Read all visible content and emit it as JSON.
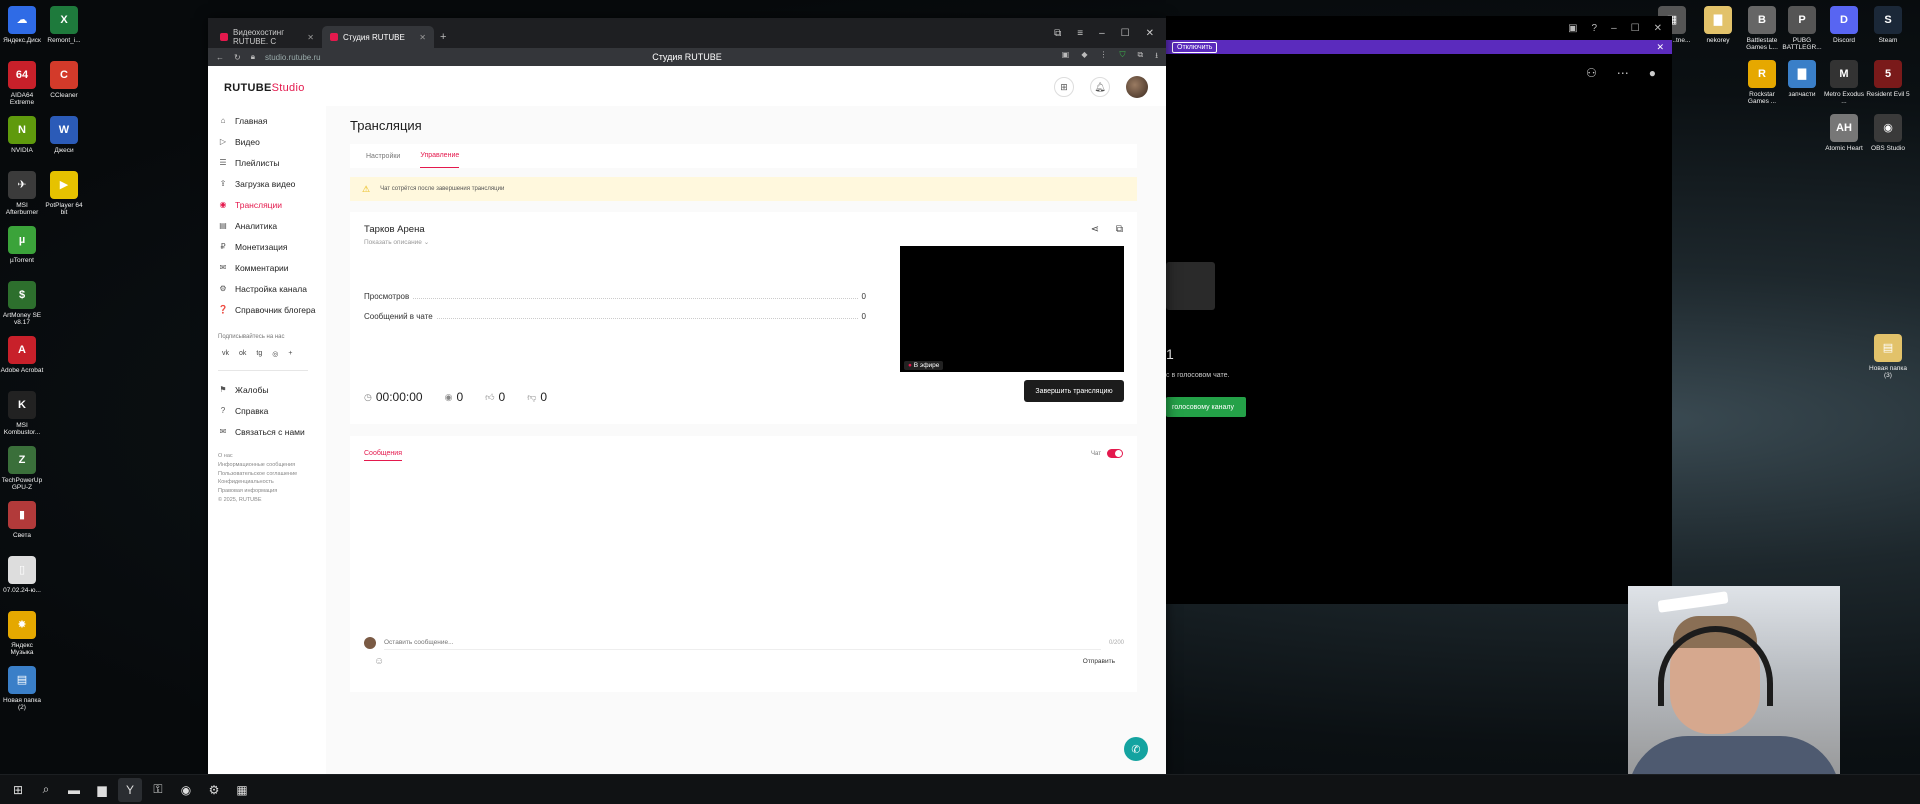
{
  "desktop": {
    "icons_left": [
      {
        "label": "Яндекс.Диск",
        "glyph": "☁",
        "color": "#2f6be6"
      },
      {
        "label": "AIDA64 Extreme",
        "glyph": "64",
        "color": "#c8202a"
      },
      {
        "label": "NVIDIA",
        "glyph": "N",
        "color": "#5f9a0d"
      },
      {
        "label": "MSI Afterburner",
        "glyph": "✈",
        "color": "#3b3b3b"
      },
      {
        "label": "µTorrent",
        "glyph": "µ",
        "color": "#3ba33a"
      },
      {
        "label": "ArtMoney SE v8.17",
        "glyph": "$",
        "color": "#2d6f2d"
      },
      {
        "label": "Adobe Acrobat",
        "glyph": "A",
        "color": "#c8202a"
      },
      {
        "label": "MSI Kombustor...",
        "glyph": "K",
        "color": "#222222"
      },
      {
        "label": "TechPowerUp GPU-Z",
        "glyph": "Z",
        "color": "#3a6f3a"
      },
      {
        "label": "Света",
        "glyph": "▮",
        "color": "#b23a3a"
      },
      {
        "label": "07.02.24-ю...",
        "glyph": "▯",
        "color": "#dddddd"
      },
      {
        "label": "Яндекс Музыка",
        "glyph": "✸",
        "color": "#e5a800"
      },
      {
        "label": "Новая папка (2)",
        "glyph": "▤",
        "color": "#3a7fc8"
      }
    ],
    "icons_col2": [
      {
        "label": "Remont_i...",
        "glyph": "X",
        "color": "#1e7a3c"
      },
      {
        "label": "CCleaner",
        "glyph": "C",
        "color": "#d33a2a"
      },
      {
        "label": "Джеси",
        "glyph": "W",
        "color": "#2b5bb8"
      },
      {
        "label": "PotPlayer 64 bit",
        "glyph": "▶",
        "color": "#e6c200"
      }
    ],
    "icons_right": [
      {
        "label": "...lice ...tne...",
        "glyph": "▦",
        "color": "#555555"
      },
      {
        "label": "nekorey",
        "glyph": "▇",
        "color": "#e2c26a"
      },
      {
        "label": "Battlestate Games L...",
        "glyph": "B",
        "color": "#666666"
      },
      {
        "label": "PUBG BATTLEGR...",
        "glyph": "P",
        "color": "#555555"
      },
      {
        "label": "Discord",
        "glyph": "D",
        "color": "#5865f2"
      },
      {
        "label": "Steam",
        "glyph": "S",
        "color": "#1b2838"
      },
      {
        "label": "Rockstar Games ...",
        "glyph": "R",
        "color": "#e6a800"
      },
      {
        "label": "запчасти",
        "glyph": "▇",
        "color": "#3a7fc8"
      },
      {
        "label": "Metro Exodus ...",
        "glyph": "M",
        "color": "#333333"
      },
      {
        "label": "Resident Evil 5",
        "glyph": "5",
        "color": "#7a1a1a"
      },
      {
        "label": "Atomic Heart",
        "glyph": "AH",
        "color": "#777777"
      },
      {
        "label": "OBS Studio",
        "glyph": "◉",
        "color": "#3a3a3a"
      },
      {
        "label": "Новая папка (3)",
        "glyph": "▤",
        "color": "#e2c26a"
      }
    ]
  },
  "dark_app": {
    "disconnect_label": "Отключить",
    "count_text": "1",
    "voice_text": "с в голосовом чате.",
    "voice_button": "голосовому каналу"
  },
  "browser": {
    "tabs": [
      {
        "label": "Видеохостинг RUTUBE. С",
        "active": false
      },
      {
        "label": "Студия RUTUBE",
        "active": true
      }
    ],
    "new_tab": "+",
    "url": "studio.rutube.ru",
    "page_title": "Студия RUTUBE"
  },
  "studio": {
    "logo_main": "RUTUBE",
    "logo_sub": "Studio",
    "nav": [
      {
        "label": "Главная",
        "icon": "⌂",
        "name": "home",
        "active": false
      },
      {
        "label": "Видео",
        "icon": "▷",
        "name": "video",
        "active": false
      },
      {
        "label": "Плейлисты",
        "icon": "☰",
        "name": "playlists",
        "active": false
      },
      {
        "label": "Загрузка видео",
        "icon": "⇪",
        "name": "upload",
        "active": false
      },
      {
        "label": "Трансляции",
        "icon": "◉",
        "name": "streams",
        "active": true
      },
      {
        "label": "Аналитика",
        "icon": "▤",
        "name": "analytics",
        "active": false
      },
      {
        "label": "Монетизация",
        "icon": "₽",
        "name": "monetization",
        "active": false
      },
      {
        "label": "Комментарии",
        "icon": "✉",
        "name": "comments",
        "active": false
      },
      {
        "label": "Настройка канала",
        "icon": "⚙",
        "name": "channel-settings",
        "active": false
      },
      {
        "label": "Справочник блогера",
        "icon": "❓",
        "name": "blogger-guide",
        "active": false
      }
    ],
    "follow_label": "Подписывайтесь на нас",
    "socials": [
      "vk",
      "ok",
      "tg",
      "◎",
      "+"
    ],
    "nav2": [
      {
        "label": "Жалобы",
        "icon": "⚑",
        "name": "complaints"
      },
      {
        "label": "Справка",
        "icon": "?",
        "name": "help"
      },
      {
        "label": "Связаться с нами",
        "icon": "✉",
        "name": "contact"
      }
    ],
    "footer": [
      "О нас",
      "Информационные сообщения",
      "Пользовательское соглашение",
      "Конфиденциальность",
      "Правовая информация",
      "© 2025, RUTUBE"
    ],
    "page_title": "Трансляция",
    "page_tabs": [
      {
        "label": "Настройки",
        "active": false
      },
      {
        "label": "Управление",
        "active": true
      }
    ],
    "warning": "Чат сотрётся после завершения трансляции",
    "stream": {
      "title": "Тарков Арена",
      "show_description": "Показать описание",
      "stats": [
        {
          "label": "Просмотров",
          "value": "0"
        },
        {
          "label": "Сообщений в чате",
          "value": "0"
        }
      ],
      "live_badge": "В эфире",
      "timer": "00:00:00",
      "viewers": "0",
      "likes": "0",
      "dislikes": "0",
      "end_button": "Завершить трансляцию"
    },
    "chat": {
      "tab_label": "Сообщения",
      "toggle_label": "Чат",
      "input_placeholder": "Оставить сообщение...",
      "counter": "0/200",
      "send_label": "Отправить"
    }
  }
}
